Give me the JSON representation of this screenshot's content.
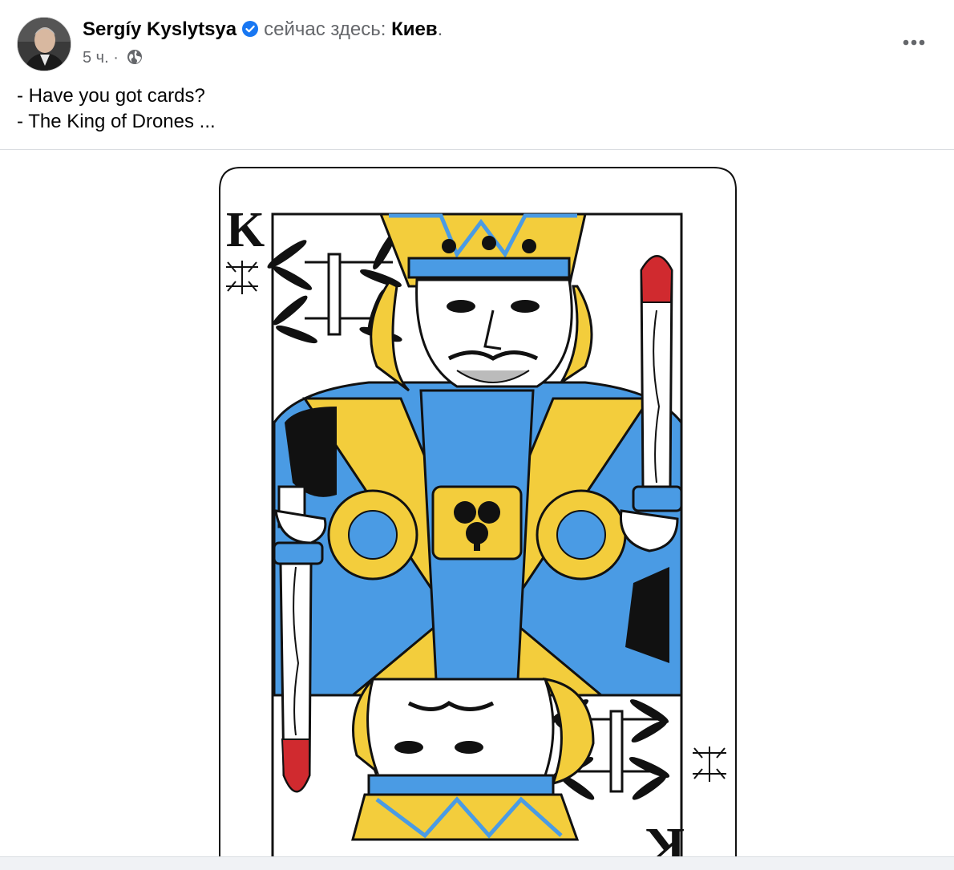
{
  "post": {
    "author": "Sergíy Kyslytsya",
    "status_prefix": "сейчас здесь:",
    "location": "Киев",
    "location_suffix": ".",
    "time": "5 ч.",
    "separator": "·",
    "text_lines": [
      "- Have you got cards?",
      "- The King of Drones ..."
    ]
  },
  "card": {
    "rank": "K",
    "colors": {
      "blue": "#4a9be4",
      "yellow": "#f3cd3c",
      "black": "#111111",
      "red": "#d02a2f",
      "skin": "#ffffff"
    }
  },
  "icons": {
    "verified": "verified-badge-icon",
    "audience": "globe-icon",
    "more": "more-options-icon"
  },
  "colors": {
    "accent": "#1877f2",
    "secondary_text": "#65676b",
    "divider": "#dadde1"
  }
}
